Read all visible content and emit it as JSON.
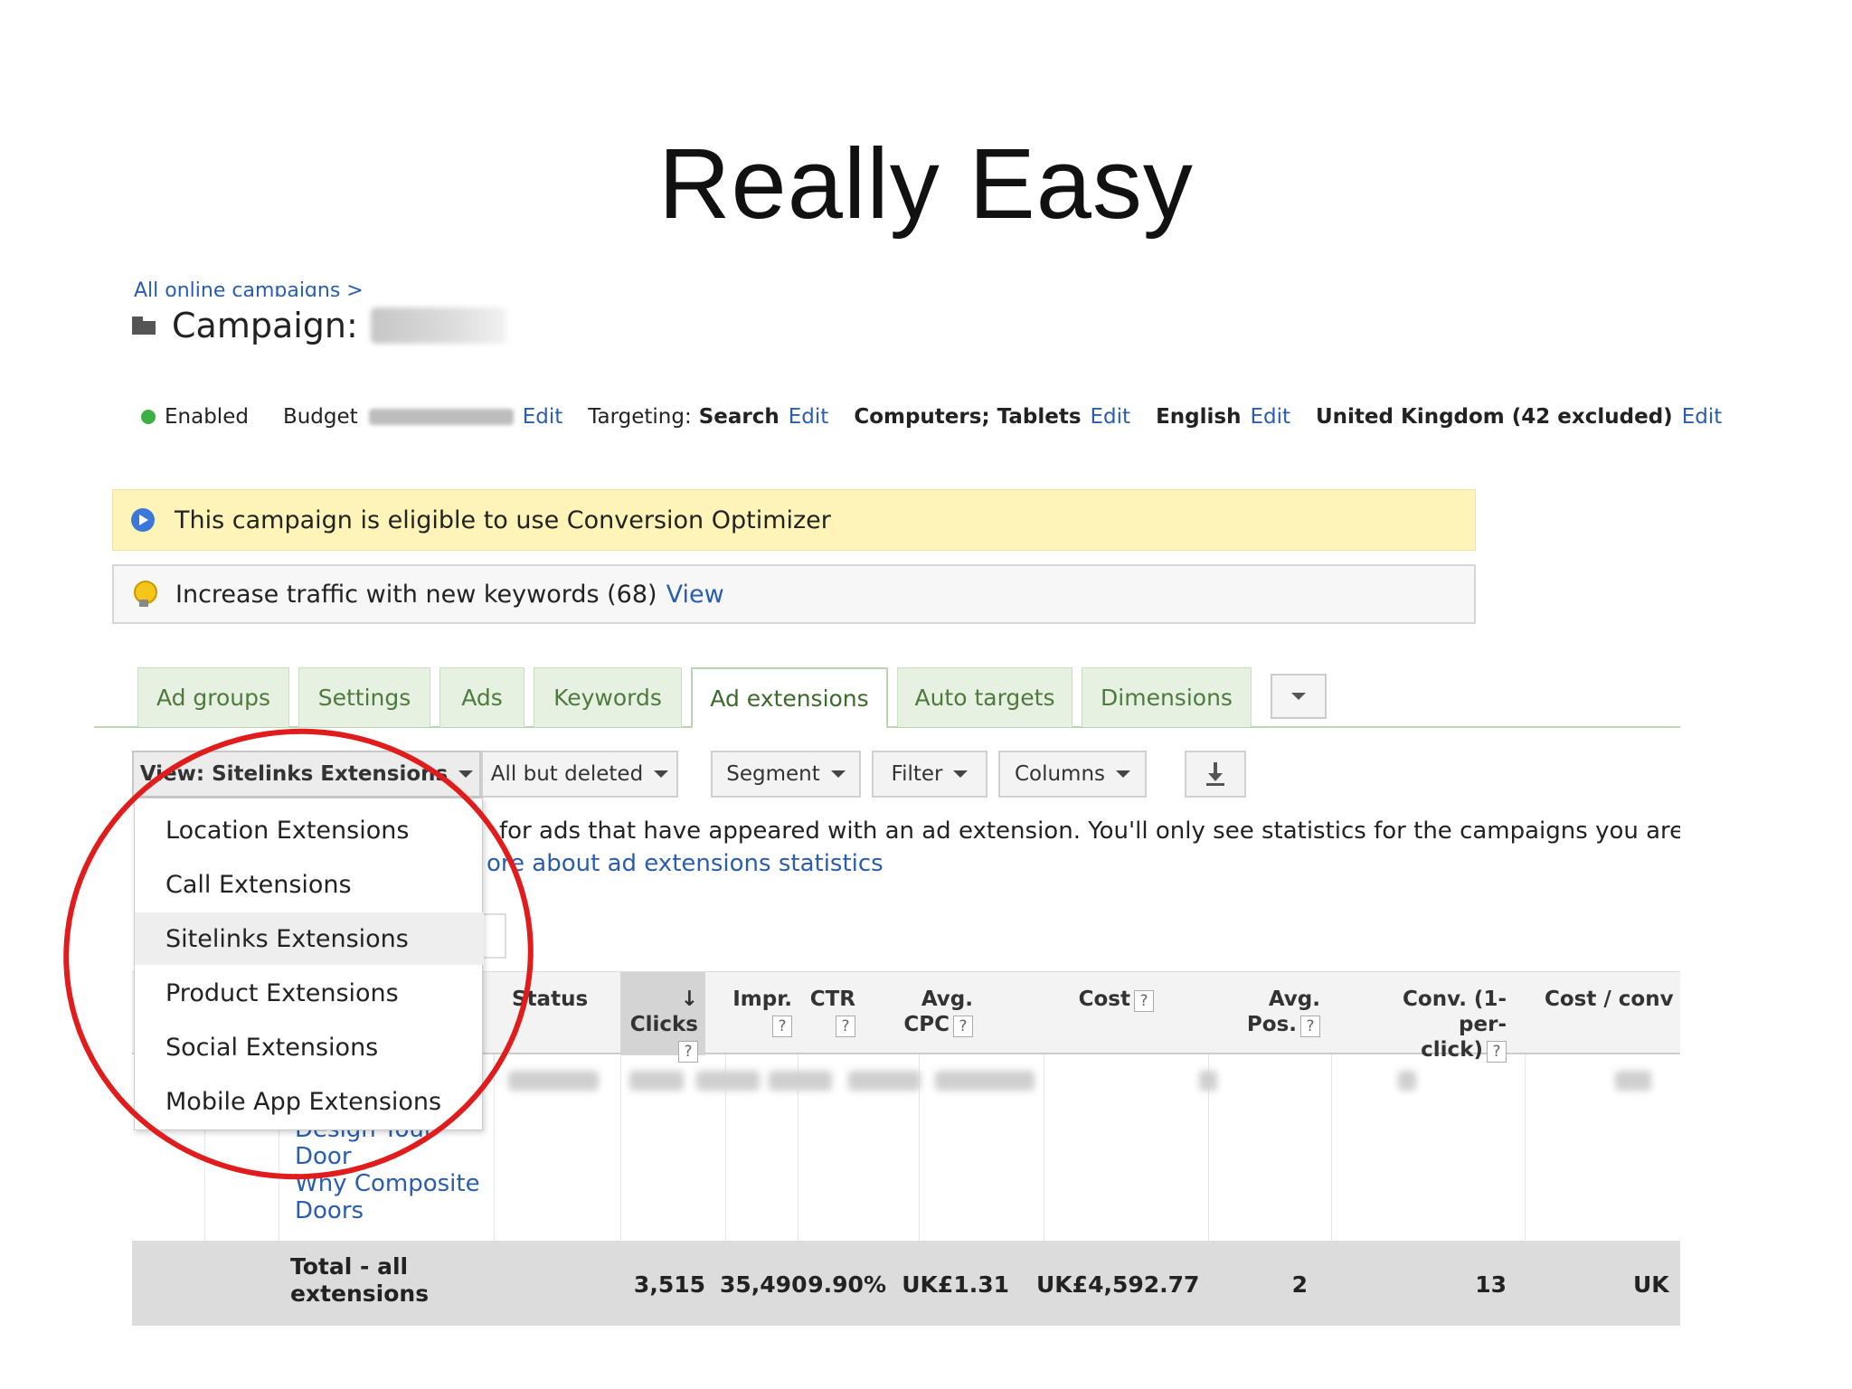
{
  "slide": {
    "title": "Really Easy"
  },
  "breadcrumb": {
    "text": "All online campaigns >"
  },
  "campaign": {
    "label": "Campaign:"
  },
  "status_bar": {
    "status": "Enabled",
    "budget_label": "Budget",
    "edit": "Edit",
    "targeting_label": "Targeting:",
    "targeting_value": "Search",
    "devices": "Computers; Tablets",
    "language": "English",
    "location": "United Kingdom (42 excluded)"
  },
  "notices": {
    "optimizer": "This campaign is eligible to use Conversion Optimizer",
    "keywords": "Increase traffic with new keywords (68)",
    "keywords_link": "View"
  },
  "tabs": [
    {
      "label": "Ad groups"
    },
    {
      "label": "Settings"
    },
    {
      "label": "Ads"
    },
    {
      "label": "Keywords"
    },
    {
      "label": "Ad extensions"
    },
    {
      "label": "Auto targets"
    },
    {
      "label": "Dimensions"
    }
  ],
  "toolbar": {
    "view": "View: Sitelinks Extensions",
    "filter_state": "All but deleted",
    "segment": "Segment",
    "filter": "Filter",
    "columns": "Columns"
  },
  "info": {
    "text": "for ads that have appeared with an ad extension. You'll only see statistics for the campaigns you are curre",
    "link": "ore about ad extensions statistics"
  },
  "dropdown": {
    "items": [
      {
        "label": "Location Extensions"
      },
      {
        "label": "Call Extensions"
      },
      {
        "label": "Sitelinks Extensions"
      },
      {
        "label": "Product Extensions"
      },
      {
        "label": "Social Extensions"
      },
      {
        "label": "Mobile App Extensions"
      }
    ],
    "selected": "Sitelinks Extensions"
  },
  "table": {
    "headers": {
      "status": "Status",
      "clicks": "Clicks",
      "impr": "Impr.",
      "ctr": "CTR",
      "avg_cpc_1": "Avg.",
      "avg_cpc_2": "CPC",
      "cost": "Cost",
      "avg_pos_1": "Avg.",
      "avg_pos_2": "Pos.",
      "conv_1": "Conv. (1-per-",
      "conv_2": "click)",
      "cost_conv": "Cost / conv",
      "help": "?"
    },
    "extension_links": [
      "Design Your",
      "Door",
      "Why Composite",
      "Doors"
    ],
    "total": {
      "label_1": "Total - all",
      "label_2": "extensions",
      "clicks": "3,515",
      "impr": "35,490",
      "ctr": "9.90%",
      "avg_cpc": "UK£1.31",
      "cost": "UK£4,592.77",
      "avg_pos": "2",
      "conv": "13",
      "cost_conv": "UK"
    }
  },
  "colors": {
    "link": "#2a5db0",
    "tab_green": "#4e7a3e",
    "notice_yellow": "#fff4b8",
    "annotation_red": "#e01c1c"
  }
}
